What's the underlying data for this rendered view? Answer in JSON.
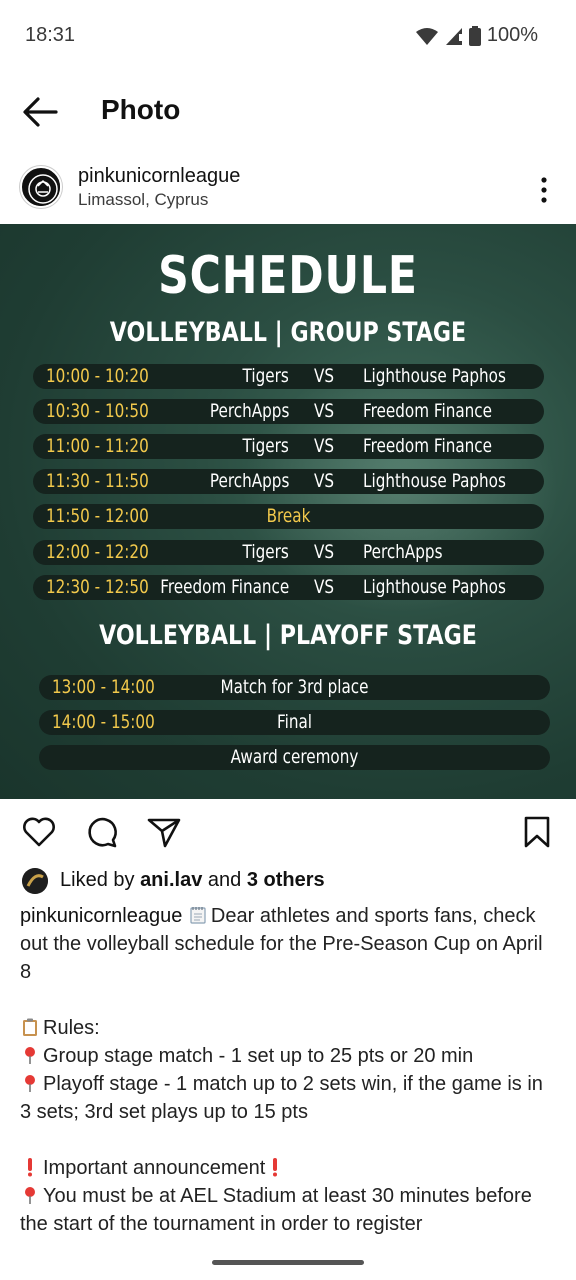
{
  "status": {
    "time": "18:31",
    "battery": "100%"
  },
  "appbar": {
    "title": "Photo"
  },
  "post": {
    "username": "pinkunicornleague",
    "location": "Limassol, Cyprus"
  },
  "poster": {
    "title": "SCHEDULE",
    "group_heading": "VOLLEYBALL | GROUP STAGE",
    "vs_label": "VS",
    "group_rows": [
      {
        "time": "10:00 - 10:20",
        "team_a": "Tigers",
        "team_b": "Lighthouse Paphos"
      },
      {
        "time": "10:30 - 10:50",
        "team_a": "PerchApps",
        "team_b": "Freedom Finance"
      },
      {
        "time": "11:00 - 11:20",
        "team_a": "Tigers",
        "team_b": "Freedom Finance"
      },
      {
        "time": "11:30 - 11:50",
        "team_a": "PerchApps",
        "team_b": "Lighthouse Paphos"
      },
      {
        "time": "11:50 - 12:00",
        "break": "Break"
      },
      {
        "time": "12:00 - 12:20",
        "team_a": "Tigers",
        "team_b": "PerchApps"
      },
      {
        "time": "12:30 - 12:50",
        "team_a": "Freedom Finance",
        "team_b": "Lighthouse Paphos"
      }
    ],
    "playoff_heading": "VOLLEYBALL | PLAYOFF STAGE",
    "playoff_rows": [
      {
        "time": "13:00 - 14:00",
        "event": "Match for 3rd place"
      },
      {
        "time": "14:00 - 15:00",
        "event": "Final"
      },
      {
        "time": "",
        "event": "Award ceremony"
      }
    ]
  },
  "likes": {
    "prefix": "Liked by ",
    "user": "ani.lav",
    "middle": " and ",
    "others": "3 others"
  },
  "caption": {
    "user": "pinkunicornleague",
    "line1": "Dear athletes and sports fans, check out the volleyball schedule for the Pre-Season Cup on April 8",
    "rules_title": "Rules:",
    "rule1": "Group stage match - 1 set up to 25 pts or 20 min",
    "rule2": "Playoff stage - 1 match up to 2 sets win, if the game is in 3 sets; 3rd set plays up to 15 pts",
    "important": "Important announcement",
    "notice": "You must be at AEL Stadium at least 30 minutes before the start of the tournament in order to register"
  },
  "colors": {
    "poster_bg": "#2b4e42",
    "time_yellow": "#f2c94c",
    "row_bg": "#15231e"
  }
}
